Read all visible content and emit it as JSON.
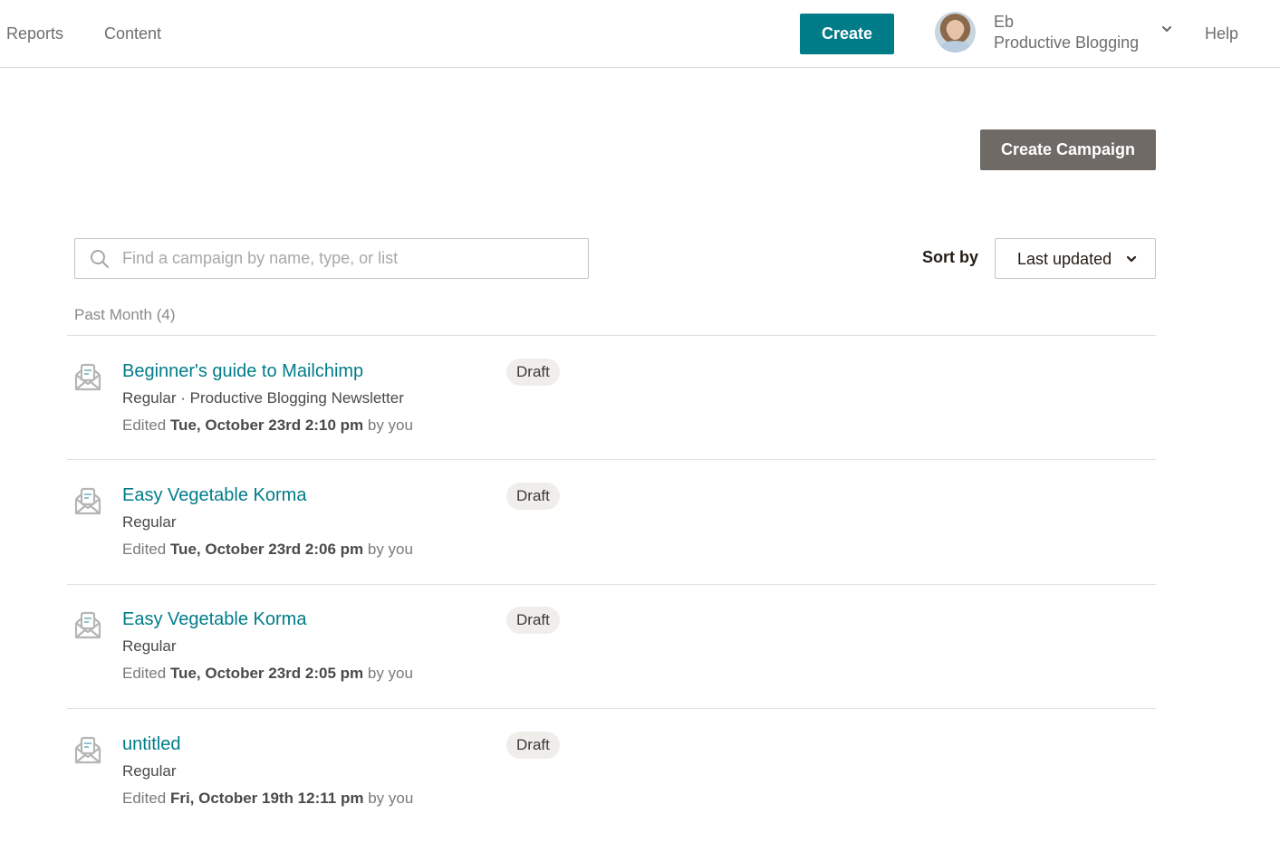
{
  "nav": {
    "links": [
      "Reports",
      "Content"
    ],
    "create_label": "Create",
    "account": {
      "user_name": "Eb",
      "org_name": "Productive Blogging"
    },
    "help_label": "Help"
  },
  "toolbar": {
    "create_campaign_label": "Create Campaign",
    "search_placeholder": "Find a campaign by name, type, or list",
    "search_value": "",
    "sort_label": "Sort by",
    "sort_value": "Last updated"
  },
  "groups": [
    {
      "label": "Past Month (4)",
      "campaigns": [
        {
          "title": "Beginner's guide to Mailchimp",
          "subtitle": "Regular · Productive Blogging Newsletter",
          "edited_prefix": "Edited",
          "edited_date": "Tue, October 23rd 2:10 pm",
          "edited_suffix": "by you",
          "status": "Draft"
        },
        {
          "title": "Easy Vegetable Korma",
          "subtitle": "Regular",
          "edited_prefix": "Edited",
          "edited_date": "Tue, October 23rd 2:06 pm",
          "edited_suffix": "by you",
          "status": "Draft"
        },
        {
          "title": "Easy Vegetable Korma",
          "subtitle": "Regular",
          "edited_prefix": "Edited",
          "edited_date": "Tue, October 23rd 2:05 pm",
          "edited_suffix": "by you",
          "status": "Draft"
        },
        {
          "title": "untitled",
          "subtitle": "Regular",
          "edited_prefix": "Edited",
          "edited_date": "Fri, October 19th 12:11 pm",
          "edited_suffix": "by you",
          "status": "Draft"
        }
      ]
    }
  ],
  "icons": {
    "search": "search-icon",
    "chevron": "chevron-down-icon",
    "campaign": "email-campaign-icon"
  },
  "colors": {
    "primary": "#007c89",
    "secondary_button": "#6f6a65",
    "badge_bg": "#efeeea"
  }
}
